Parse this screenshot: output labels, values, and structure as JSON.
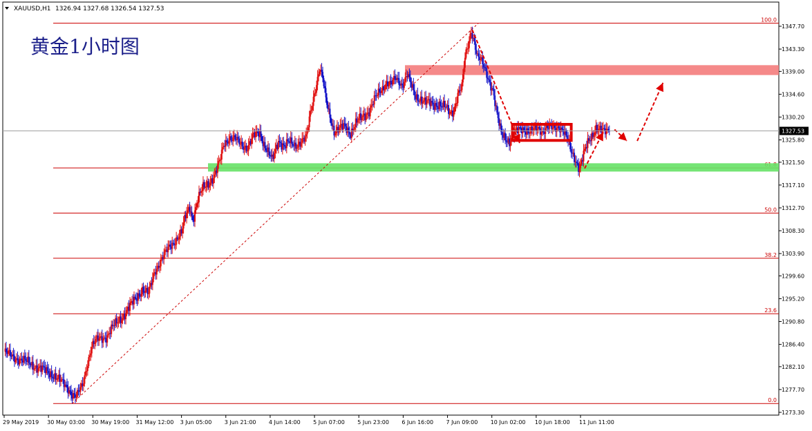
{
  "header": {
    "symbol": "XAUUSD,H1",
    "ohlc": "1326.94 1327.68 1326.54 1327.53"
  },
  "annotation_title": "黄金1小时图",
  "colors": {
    "bull": "#e01010",
    "bear": "#1414c8",
    "fib_line": "#cc0000",
    "resistance_zone": "#f47c7c",
    "support_zone": "#66e266",
    "price_marker_bg": "#000000"
  },
  "chart_data": {
    "type": "candlestick",
    "title": "黄金1小时图",
    "ylim": [
      1273.3,
      1349.6
    ],
    "y_ticks": [
      "1347.70",
      "1343.30",
      "1339.00",
      "1334.60",
      "1330.20",
      "1325.80",
      "1321.50",
      "1317.10",
      "1312.70",
      "1308.30",
      "1303.90",
      "1299.60",
      "1295.20",
      "1290.80",
      "1286.40",
      "1282.10",
      "1277.70",
      "1273.30"
    ],
    "x_ticks": [
      "29 May 2019",
      "30 May 03:00",
      "30 May 19:00",
      "31 May 12:00",
      "3 Jun 05:00",
      "3 Jun 21:00",
      "4 Jun 14:00",
      "5 Jun 07:00",
      "5 Jun 23:00",
      "6 Jun 16:00",
      "7 Jun 09:00",
      "10 Jun 02:00",
      "10 Jun 18:00",
      "11 Jun 11:00"
    ],
    "current_price": "1327.53",
    "fib_levels": [
      {
        "label": "100.0",
        "price": 1348.3
      },
      {
        "label": "61.8",
        "price": 1320.4
      },
      {
        "label": "50.0",
        "price": 1311.7
      },
      {
        "label": "38.2",
        "price": 1303.0
      },
      {
        "label": "23.6",
        "price": 1292.3
      },
      {
        "label": "0.0",
        "price": 1275.0
      }
    ],
    "zones": [
      {
        "name": "resistance",
        "from": 1338.3,
        "to": 1340.2
      },
      {
        "name": "support",
        "from": 1319.7,
        "to": 1321.3
      }
    ],
    "path_points": [
      [
        0,
        1285.0
      ],
      [
        8,
        1284.0
      ],
      [
        16,
        1283.5
      ],
      [
        24,
        1282.8
      ],
      [
        32,
        1282.0
      ],
      [
        40,
        1281.3
      ],
      [
        48,
        1280.5
      ],
      [
        56,
        1279.0
      ],
      [
        62,
        1278.0
      ],
      [
        66,
        1276.8
      ],
      [
        70,
        1276.2
      ],
      [
        76,
        1278.5
      ],
      [
        81,
        1283.0
      ],
      [
        85,
        1286.0
      ],
      [
        92,
        1287.5
      ],
      [
        100,
        1288.0
      ],
      [
        106,
        1289.8
      ],
      [
        112,
        1291.2
      ],
      [
        118,
        1292.5
      ],
      [
        126,
        1294.8
      ],
      [
        134,
        1297.0
      ],
      [
        140,
        1296.0
      ],
      [
        146,
        1300.5
      ],
      [
        152,
        1302.5
      ],
      [
        160,
        1305.0
      ],
      [
        166,
        1306.5
      ],
      [
        172,
        1307.8
      ],
      [
        176,
        1311.0
      ],
      [
        180,
        1313.0
      ],
      [
        183,
        1310.5
      ],
      [
        188,
        1314.3
      ],
      [
        193,
        1316.5
      ],
      [
        198,
        1317.5
      ],
      [
        204,
        1318.8
      ],
      [
        209,
        1321.5
      ],
      [
        213,
        1325.0
      ],
      [
        218,
        1326.2
      ],
      [
        224,
        1325.8
      ],
      [
        230,
        1325.0
      ],
      [
        236,
        1324.3
      ],
      [
        242,
        1326.5
      ],
      [
        248,
        1327.3
      ],
      [
        252,
        1325.0
      ],
      [
        256,
        1323.3
      ],
      [
        260,
        1321.8
      ],
      [
        266,
        1325.8
      ],
      [
        272,
        1324.5
      ],
      [
        276,
        1325.3
      ],
      [
        282,
        1324.8
      ],
      [
        288,
        1325.5
      ],
      [
        293,
        1326.0
      ],
      [
        297,
        1331.0
      ],
      [
        301,
        1335.0
      ],
      [
        306,
        1339.5
      ],
      [
        309,
        1337.5
      ],
      [
        312,
        1333.5
      ],
      [
        316,
        1330.5
      ],
      [
        320,
        1327.5
      ],
      [
        325,
        1327.8
      ],
      [
        330,
        1328.5
      ],
      [
        336,
        1327.2
      ],
      [
        342,
        1329.2
      ],
      [
        348,
        1330.3
      ],
      [
        354,
        1331.5
      ],
      [
        360,
        1333.8
      ],
      [
        366,
        1335.5
      ],
      [
        371,
        1337.0
      ],
      [
        375,
        1336.5
      ],
      [
        380,
        1337.5
      ],
      [
        386,
        1336.5
      ],
      [
        391,
        1338.5
      ],
      [
        395,
        1336.0
      ],
      [
        399,
        1334.0
      ],
      [
        404,
        1333.8
      ],
      [
        410,
        1333.0
      ],
      [
        416,
        1332.5
      ],
      [
        422,
        1332.8
      ],
      [
        428,
        1332.0
      ],
      [
        432,
        1330.8
      ],
      [
        436,
        1331.5
      ],
      [
        440,
        1334.8
      ],
      [
        444,
        1336.0
      ],
      [
        447,
        1341.5
      ],
      [
        450,
        1344.0
      ],
      [
        453,
        1347.0
      ],
      [
        456,
        1344.8
      ],
      [
        459,
        1341.8
      ],
      [
        462,
        1341.0
      ],
      [
        466,
        1339.5
      ],
      [
        470,
        1337.5
      ],
      [
        474,
        1335.5
      ],
      [
        478,
        1330.5
      ],
      [
        482,
        1327.0
      ],
      [
        486,
        1326.3
      ],
      [
        490,
        1325.5
      ],
      [
        494,
        1326.8
      ],
      [
        498,
        1327.5
      ],
      [
        502,
        1328.0
      ],
      [
        506,
        1327.8
      ],
      [
        510,
        1327.3
      ],
      [
        514,
        1327.6
      ],
      [
        518,
        1328.0
      ],
      [
        522,
        1327.5
      ],
      [
        526,
        1328.3
      ],
      [
        530,
        1328.0
      ],
      [
        534,
        1327.8
      ],
      [
        538,
        1328.5
      ],
      [
        542,
        1327.8
      ],
      [
        546,
        1326.0
      ],
      [
        550,
        1323.3
      ],
      [
        554,
        1322.0
      ],
      [
        558,
        1320.5
      ],
      [
        562,
        1323.0
      ],
      [
        566,
        1325.0
      ],
      [
        570,
        1326.5
      ],
      [
        574,
        1328.3
      ],
      [
        578,
        1327.8
      ],
      [
        582,
        1327.2
      ],
      [
        586,
        1327.53
      ]
    ],
    "arrows": [
      {
        "from": [
          454,
          1347.0
        ],
        "to": [
          500,
          1325.2
        ]
      },
      {
        "from": [
          563,
          1320.3
        ],
        "to": [
          581,
          1327.3
        ]
      },
      {
        "from": [
          592,
          1327.8
        ],
        "to": [
          604,
          1325.6
        ]
      },
      {
        "from": [
          614,
          1325.6
        ],
        "to": [
          639,
          1336.8
        ]
      }
    ],
    "trendline": {
      "from": [
        66,
        1275.0
      ],
      "to": [
        460,
        1348.3
      ]
    },
    "consolidation_box": {
      "from_index": 493,
      "to_index": 550,
      "low": 1325.7,
      "high": 1328.8
    }
  }
}
